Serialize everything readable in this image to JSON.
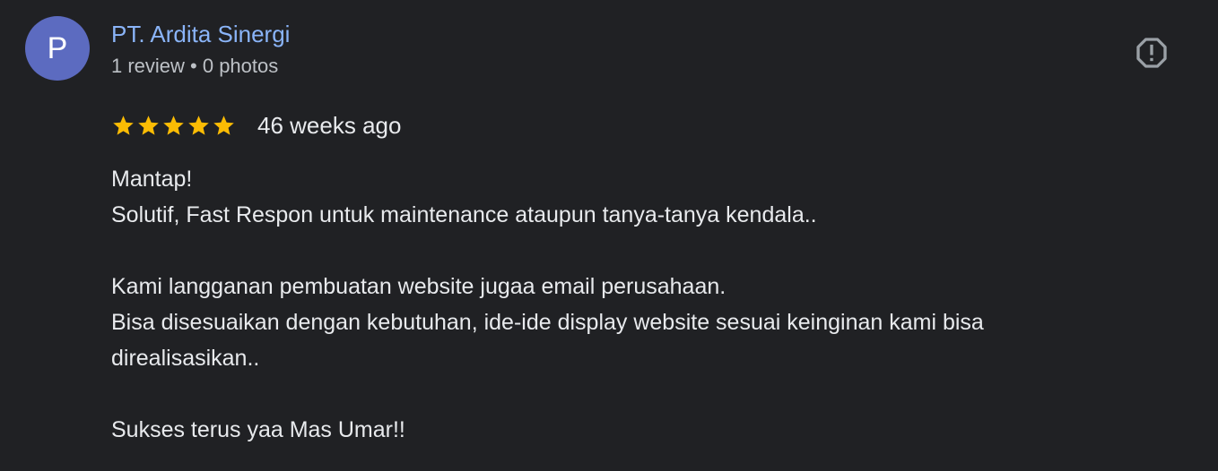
{
  "reviewer": {
    "avatar_letter": "P",
    "name": "PT. Ardita Sinergi",
    "meta": "1 review • 0 photos"
  },
  "review": {
    "rating": 5,
    "max_rating": 5,
    "date": "46 weeks ago",
    "lines": [
      "Mantap!",
      "Solutif, Fast Respon untuk maintenance ataupun tanya-tanya kendala..",
      "",
      "Kami langganan pembuatan website jugaa email perusahaan.",
      "Bisa disesuaikan dengan kebutuhan, ide-ide display website sesuai keinginan kami bisa",
      "direalisasikan..",
      "",
      "Sukses terus yaa Mas Umar!!"
    ]
  },
  "icons": {
    "report": "report-flag-icon",
    "star": "star-icon"
  },
  "colors": {
    "background": "#202124",
    "avatar": "#5c6bc0",
    "name": "#8ab4f8",
    "star": "#fbbc04",
    "text": "#e8eaed",
    "meta": "#bdc1c6",
    "icon": "#9aa0a6"
  }
}
